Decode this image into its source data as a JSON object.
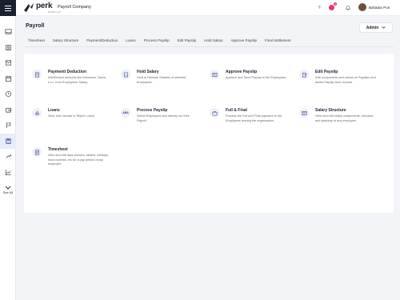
{
  "header": {
    "brand": "perk",
    "brand_sub": "PAYROLL CO.",
    "company": "Payroll Company",
    "notif_count": "2",
    "user_name": "Bahadur Pun"
  },
  "sidebar": {
    "icons": [
      "inbox-icon",
      "user-icon",
      "mail-icon",
      "calendar-icon",
      "clock-icon",
      "wallet-icon",
      "flag-icon",
      "calculator-icon",
      "share-icon",
      "chart-icon"
    ],
    "see_all_label": "See All"
  },
  "page": {
    "title": "Payroll",
    "role": "Admin"
  },
  "tabs": [
    "Timesheet",
    "Salary Structure",
    "Payment/Deduction",
    "Loans",
    "Process Payslip",
    "Edit Payslip",
    "Hold Salary",
    "Approve Payslip",
    "Final Settlement"
  ],
  "items": [
    {
      "title": "Payment/ Deduction",
      "desc": "Add/Deduct amounts like Advances, Taxes, e.t.c. from Employees' Salary.",
      "icon": "document-icon"
    },
    {
      "title": "Hold Salary",
      "desc": "Hold or Release Salaries of selected Employees.",
      "icon": "wallet-icon"
    },
    {
      "title": "Approve Payslip",
      "desc": "Approve and Send Payslip to the Employees.",
      "icon": "payslip-icon"
    },
    {
      "title": "Edit Payslip",
      "desc": "Edit components and values on Payslips And delete Payslip from records.",
      "icon": "edit-icon"
    },
    {
      "title": "Loans",
      "desc": "View, Add, Accept or Reject Loans.",
      "icon": "loan-icon"
    },
    {
      "title": "Process Payslip",
      "desc": "Select Employees and directly run their Payroll.",
      "icon": "process-icon",
      "icon_text": "ABA"
    },
    {
      "title": "Full & Final",
      "desc": "Process the Full and Final payment to the Employees leaving the organisation.",
      "icon": "briefcase-icon"
    },
    {
      "title": "Salary Structure",
      "desc": "View and edit salary components, structure, and statutory of any employee.",
      "icon": "structure-icon"
    },
    {
      "title": "Timesheet",
      "desc": "View and edit days present, absent, holidays, hours worked, etc for a pay period of any employee.",
      "icon": "timesheet-icon"
    }
  ]
}
